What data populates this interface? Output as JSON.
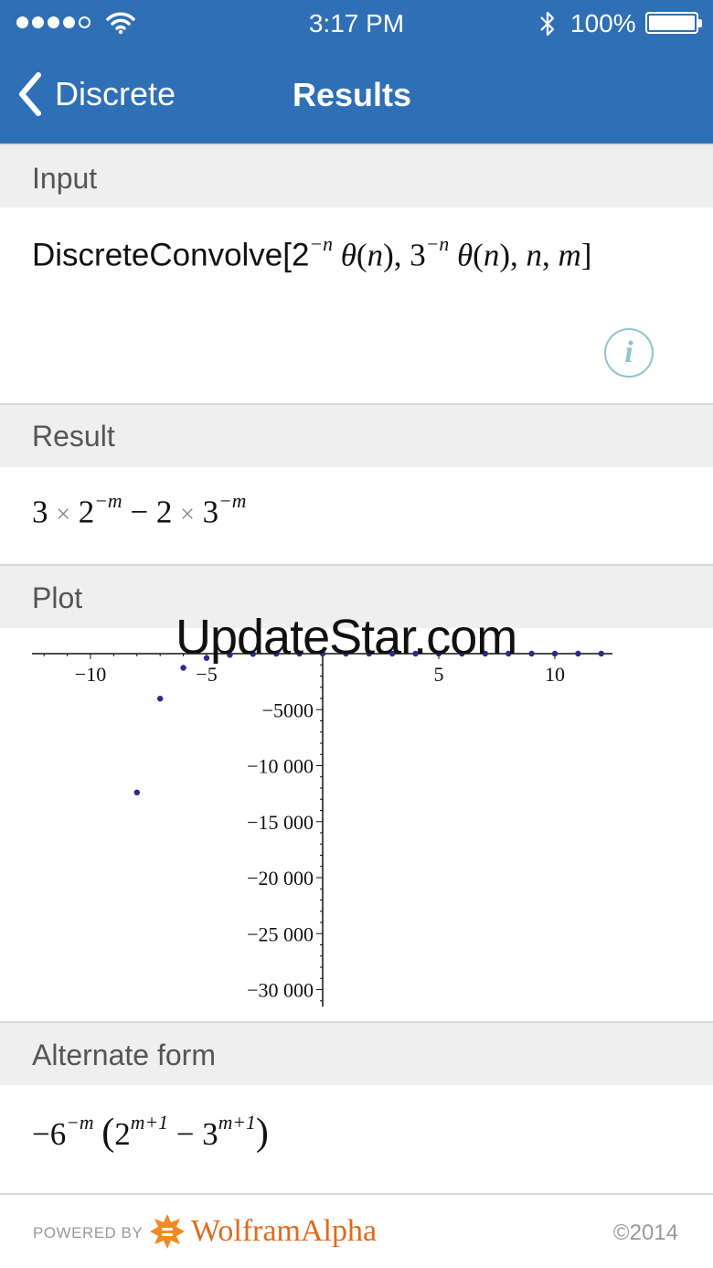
{
  "status_bar": {
    "time": "3:17 PM",
    "battery_percent": "100%",
    "signal_bars_filled": 4,
    "signal_bars_total": 5
  },
  "nav": {
    "back_label": "Discrete",
    "title": "Results"
  },
  "sections": {
    "input": {
      "header": "Input",
      "expr_prefix": "DiscreteConvolve[2",
      "info_icon": "i"
    },
    "result": {
      "header": "Result"
    },
    "plot": {
      "header": "Plot",
      "watermark": "UpdateStar.com"
    },
    "alternate": {
      "header": "Alternate form"
    }
  },
  "chart_data": {
    "type": "scatter",
    "x_ticks": [
      "−10",
      "−5",
      "5",
      "10"
    ],
    "y_ticks": [
      "−5000",
      "−10 000",
      "−15 000",
      "−20 000",
      "−25 000",
      "−30 000"
    ],
    "xlim": [
      -12.8,
      12.8
    ],
    "ylim": [
      -31000,
      0
    ],
    "points": [
      {
        "x": -8,
        "y": -12393
      },
      {
        "x": -7,
        "y": -4016
      },
      {
        "x": -6,
        "y": -1266
      },
      {
        "x": -5,
        "y": -390
      },
      {
        "x": -4,
        "y": -114
      },
      {
        "x": -3,
        "y": -30
      },
      {
        "x": -2,
        "y": -6
      },
      {
        "x": -1,
        "y": 0
      },
      {
        "x": 0,
        "y": 1
      },
      {
        "x": 1,
        "y": 0.83
      },
      {
        "x": 2,
        "y": 0.53
      },
      {
        "x": 3,
        "y": 0.3
      },
      {
        "x": 4,
        "y": 0.16
      },
      {
        "x": 5,
        "y": 0.09
      },
      {
        "x": 6,
        "y": 0.04
      },
      {
        "x": 7,
        "y": 0.02
      },
      {
        "x": 8,
        "y": 0.01
      },
      {
        "x": 9,
        "y": 0.01
      },
      {
        "x": 10,
        "y": 0.0
      },
      {
        "x": 11,
        "y": 0.0
      },
      {
        "x": 12,
        "y": 0.0
      }
    ],
    "point_color": "#2b2b8a"
  },
  "footer": {
    "powered_by": "POWERED BY",
    "brand": "WolframAlpha",
    "copyright": "©2014"
  },
  "colors": {
    "nav_bar": "#2f6fb6",
    "section_header": "#efefef",
    "brand_orange": "#e06a1e",
    "info_icon": "#8ec4d6"
  }
}
